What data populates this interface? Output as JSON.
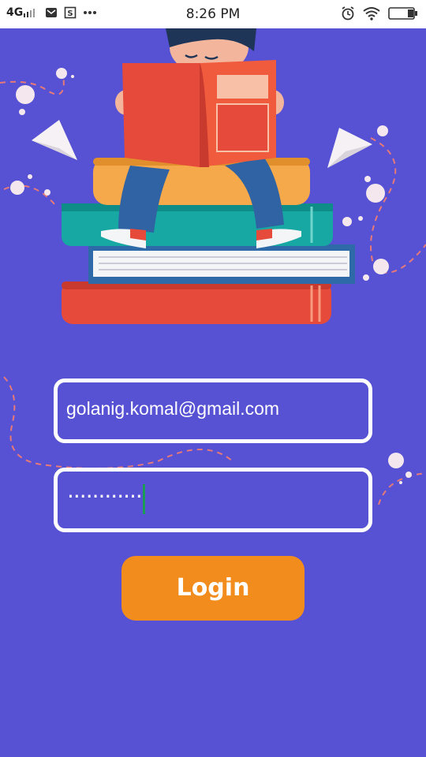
{
  "status_bar": {
    "network": "4G",
    "time": "8:26 PM",
    "icons": [
      "signal-icon",
      "mail-icon",
      "sim-icon",
      "more-icon",
      "alarm-icon",
      "wifi-icon",
      "battery-icon"
    ]
  },
  "illustration": {
    "name": "child-reading-on-books-illustration"
  },
  "login_form": {
    "email_value": "golanig.komal@gmail.com",
    "password_masked": "············",
    "login_label": "Login"
  },
  "colors": {
    "background": "#5751d4",
    "button": "#f28d1d",
    "field_border": "#ffffff",
    "caret": "#1a9c55"
  }
}
